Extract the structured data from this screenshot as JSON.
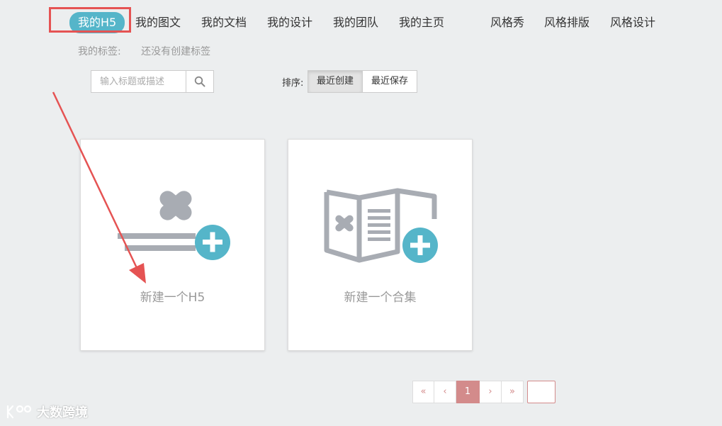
{
  "nav": {
    "items": [
      {
        "label": "我的H5",
        "active": true
      },
      {
        "label": "我的图文"
      },
      {
        "label": "我的文档"
      },
      {
        "label": "我的设计"
      },
      {
        "label": "我的团队"
      },
      {
        "label": "我的主页"
      },
      {
        "label": "风格秀"
      },
      {
        "label": "风格排版"
      },
      {
        "label": "风格设计"
      }
    ]
  },
  "tags": {
    "label": "我的标签:",
    "empty_text": "还没有创建标签"
  },
  "search": {
    "placeholder": "输入标题或描述",
    "value": "",
    "icon": "search-icon"
  },
  "sort": {
    "label": "排序:",
    "options": [
      {
        "label": "最近创建",
        "active": true
      },
      {
        "label": "最近保存"
      }
    ]
  },
  "cards": [
    {
      "label": "新建一个H5",
      "icon": "new-h5-icon"
    },
    {
      "label": "新建一个合集",
      "icon": "new-collection-icon"
    }
  ],
  "pagination": {
    "first": "«",
    "prev": "‹",
    "current": "1",
    "next": "›",
    "last": "»",
    "jump_value": ""
  },
  "watermark": {
    "text": "大数跨境"
  },
  "colors": {
    "accent": "#55b5c9",
    "icon_gray": "#a8acb3",
    "pager": "#d38b8b",
    "annotation_red": "#e55353"
  }
}
